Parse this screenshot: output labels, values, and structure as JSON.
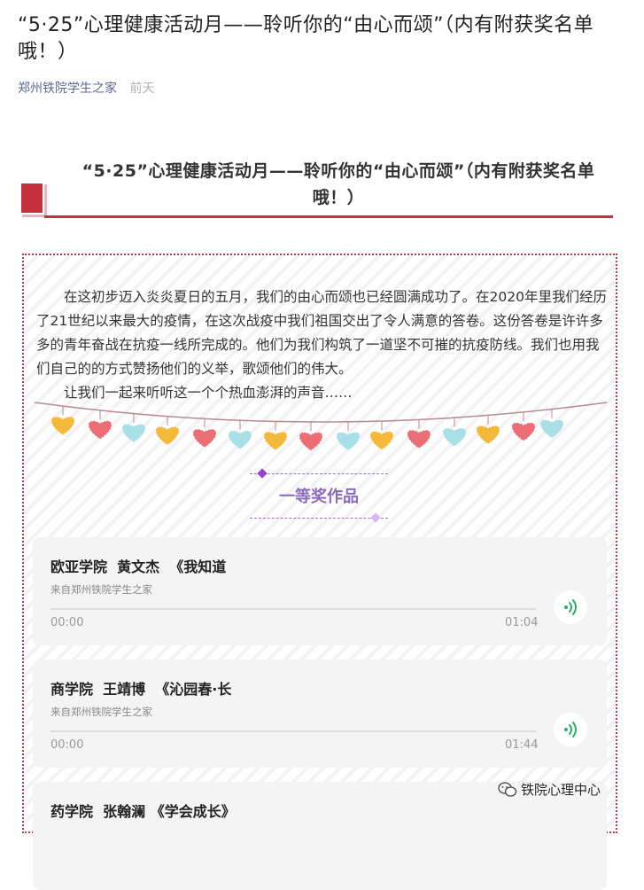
{
  "article": {
    "title": "“5·25”心理健康活动月——聆听你的“由心而颂”（内有附获奖名单哦！）",
    "account": "郑州铁院学生之家",
    "time": "前天"
  },
  "section": {
    "title": "“5·25”心理健康活动月——聆听你的“由心而颂”（内有附获奖名单哦！）"
  },
  "intro": {
    "paragraph": "在这初步迈入炎炎夏日的五月，我们的由心而颂也已经圆满成功了。在2020年里我们经历了21世纪以来最大的疫情，在这次战疫中我们祖国交出了令人满意的答卷。这份答卷是许许多多的青年奋战在抗疫一线所完成的。他们为我们构筑了一道坚不可摧的抗疫防线。我们也用我们自己的的方式赞扬他们的义举，歌颂他们的伟大。",
    "closing": "让我们一起来听听这一个个热血澎湃的声音……"
  },
  "award": {
    "label": "一等奖作品"
  },
  "audios": [
    {
      "title": "欧亚学院  黄文杰  《我知道",
      "source": "来自郑州铁院学生之家",
      "current": "00:00",
      "duration": "01:04"
    },
    {
      "title": "商学院  王靖博  《沁园春·长",
      "source": "来自郑州铁院学生之家",
      "current": "00:00",
      "duration": "01:44"
    },
    {
      "title": "药学院  张翰澜 《学会成长》",
      "source": "",
      "current": "",
      "duration": ""
    }
  ],
  "watermark": {
    "text": "铁院心理中心"
  },
  "colors": {
    "accent": "#c4313d",
    "link": "#576b95",
    "award": "#8b6bc2",
    "play": "#2aae67"
  },
  "icons": {
    "play": "audio-play-icon",
    "wechat": "wechat-icon"
  }
}
